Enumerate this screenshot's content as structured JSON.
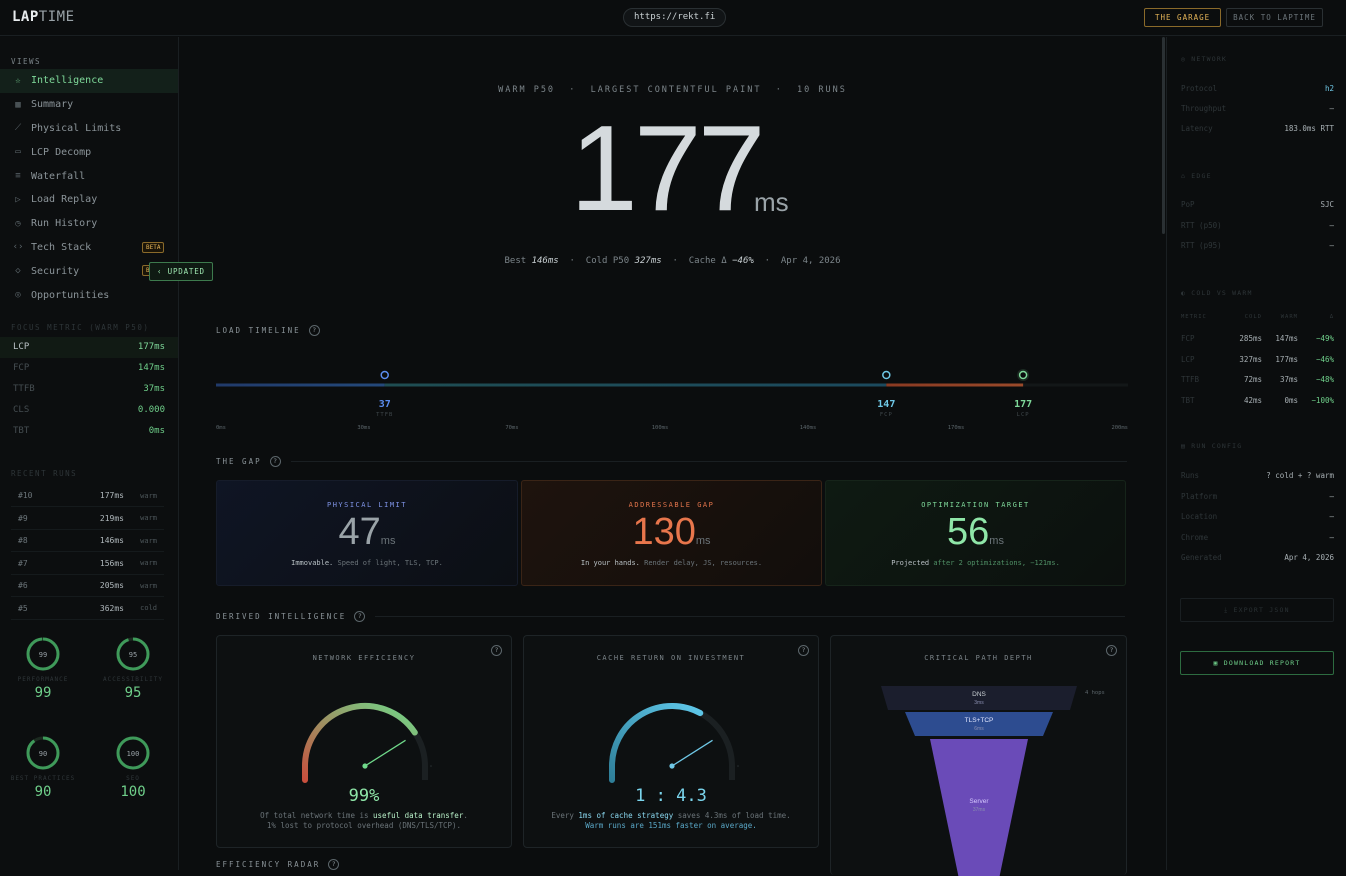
{
  "header": {
    "logo_a": "LAP",
    "logo_b": "TIME",
    "url": "https://rekt.fi",
    "garage_label": "THE GARAGE",
    "back_label": "BACK TO LAPTIME"
  },
  "sidebar": {
    "views_label": "VIEWS",
    "items": [
      {
        "label": "Intelligence",
        "icon": "star-icon",
        "active": true
      },
      {
        "label": "Summary",
        "icon": "grid-icon"
      },
      {
        "label": "Physical Limits",
        "icon": "trend-icon"
      },
      {
        "label": "LCP Decomp",
        "icon": "layers-icon"
      },
      {
        "label": "Waterfall",
        "icon": "waterfall-icon"
      },
      {
        "label": "Load Replay",
        "icon": "replay-icon"
      },
      {
        "label": "Run History",
        "icon": "clock-icon"
      },
      {
        "label": "Tech Stack",
        "icon": "code-icon",
        "badge": "BETA"
      },
      {
        "label": "Security",
        "icon": "shield-icon",
        "badge": "B"
      },
      {
        "label": "Opportunities",
        "icon": "target-icon"
      }
    ],
    "updated_tip": "UPDATED",
    "focus_label": "FOCUS METRIC (WARM P50)",
    "focus_metrics": [
      {
        "name": "LCP",
        "value": "177ms",
        "active": true
      },
      {
        "name": "FCP",
        "value": "147ms"
      },
      {
        "name": "TTFB",
        "value": "37ms"
      },
      {
        "name": "CLS",
        "value": "0.000"
      },
      {
        "name": "TBT",
        "value": "0ms"
      }
    ],
    "recent_label": "RECENT RUNS",
    "runs": [
      {
        "id": "#10",
        "ms": "177ms",
        "kind": "warm"
      },
      {
        "id": "#9",
        "ms": "219ms",
        "kind": "warm"
      },
      {
        "id": "#8",
        "ms": "146ms",
        "kind": "warm"
      },
      {
        "id": "#7",
        "ms": "156ms",
        "kind": "warm"
      },
      {
        "id": "#6",
        "ms": "205ms",
        "kind": "warm"
      },
      {
        "id": "#5",
        "ms": "362ms",
        "kind": "cold"
      }
    ],
    "scores": [
      {
        "label": "PERFORMANCE",
        "value": "99",
        "pct": 0.99
      },
      {
        "label": "ACCESSIBILITY",
        "value": "95",
        "pct": 0.95
      },
      {
        "label": "BEST PRACTICES",
        "value": "90",
        "pct": 0.9
      },
      {
        "label": "SEO",
        "value": "100",
        "pct": 1.0
      }
    ]
  },
  "hero": {
    "subtitle": "WARM P50  ·  LARGEST CONTENTFUL PAINT  ·  10 RUNS",
    "value": "177",
    "unit": "ms",
    "best_label": "Best",
    "best_value": "146ms",
    "cold_label": "Cold P50",
    "cold_value": "327ms",
    "cache_label": "Cache Δ",
    "cache_value": "−46%",
    "date": "Apr 4, 2026"
  },
  "timeline": {
    "title": "LOAD TIMELINE",
    "max": 200,
    "markers": [
      {
        "value": "37",
        "label": "TTFB",
        "color": "#5b8df0"
      },
      {
        "value": "147",
        "label": "FCP",
        "color": "#6fc8e6"
      },
      {
        "value": "177",
        "label": "LCP",
        "color": "#7fd99a"
      }
    ],
    "ticks": [
      "0ms",
      "30ms",
      "70ms",
      "100ms",
      "140ms",
      "170ms",
      "200ms"
    ]
  },
  "gap": {
    "title": "THE GAP",
    "cards": [
      {
        "title": "PHYSICAL LIMIT",
        "value": "47",
        "unit": "ms",
        "desc_strong": "Immovable.",
        "desc": " Speed of light, TLS, TCP.",
        "color": "#7f93e6",
        "num_color": "#9aa3a8"
      },
      {
        "title": "ADDRESSABLE GAP",
        "value": "130",
        "unit": "ms",
        "desc_strong": "In your hands.",
        "desc": " Render delay, JS, resources.",
        "color": "#e0734a",
        "num_color": "#e8764c"
      },
      {
        "title": "OPTIMIZATION TARGET",
        "value": "56",
        "unit": "ms",
        "desc_strong": "Projected",
        "desc": " after 2 optimizations, −121ms.",
        "color": "#7fd99a",
        "num_color": "#8fe6a8"
      }
    ]
  },
  "derived": {
    "title": "DERIVED INTELLIGENCE",
    "network": {
      "title": "NETWORK EFFICIENCY",
      "value": "99%",
      "pct": 0.99,
      "line1_a": "Of total network time is ",
      "line1_b": "useful data transfer",
      "line1_c": ".",
      "line2": "1% lost to protocol overhead (DNS/TLS/TCP)."
    },
    "cache": {
      "title": "CACHE RETURN ON INVESTMENT",
      "value": "1 : 4.3",
      "pct": 0.8,
      "line1_a": "Every ",
      "line1_b": "1ms of cache strategy",
      "line1_c": " saves 4.3ms of load time.",
      "line2": "Warm runs are 151ms faster on average."
    },
    "critical": {
      "title": "CRITICAL PATH DEPTH",
      "hops": "4 hops",
      "layers": [
        {
          "name": "DNS",
          "ms": "3ms"
        },
        {
          "name": "TLS+TCP",
          "ms": "6ms"
        },
        {
          "name": "Server",
          "ms": "37ms"
        }
      ]
    }
  },
  "radar": {
    "title": "EFFICIENCY RADAR"
  },
  "right": {
    "network_title": "NETWORK",
    "network_rows": [
      {
        "k": "Protocol",
        "v": "h2",
        "accent": true
      },
      {
        "k": "Throughput",
        "v": "—"
      },
      {
        "k": "Latency",
        "v": "183.0ms RTT"
      }
    ],
    "edge_title": "EDGE",
    "edge_rows": [
      {
        "k": "PoP",
        "v": "SJC"
      },
      {
        "k": "RTT (p50)",
        "v": "—"
      },
      {
        "k": "RTT (p95)",
        "v": "—"
      }
    ],
    "cw_title": "COLD VS WARM",
    "cw_head": [
      "METRIC",
      "COLD",
      "WARM",
      "Δ"
    ],
    "cw_rows": [
      [
        "FCP",
        "285ms",
        "147ms",
        "−49%"
      ],
      [
        "LCP",
        "327ms",
        "177ms",
        "−46%"
      ],
      [
        "TTFB",
        "72ms",
        "37ms",
        "−48%"
      ],
      [
        "TBT",
        "42ms",
        "0ms",
        "−100%"
      ]
    ],
    "run_title": "RUN CONFIG",
    "run_rows": [
      {
        "k": "Runs",
        "v": "? cold + ? warm"
      },
      {
        "k": "Platform",
        "v": "—"
      },
      {
        "k": "Location",
        "v": "—"
      },
      {
        "k": "Chrome",
        "v": "—"
      },
      {
        "k": "Generated",
        "v": "Apr 4, 2026"
      }
    ],
    "export_label": "EXPORT JSON",
    "download_label": "DOWNLOAD REPORT"
  }
}
